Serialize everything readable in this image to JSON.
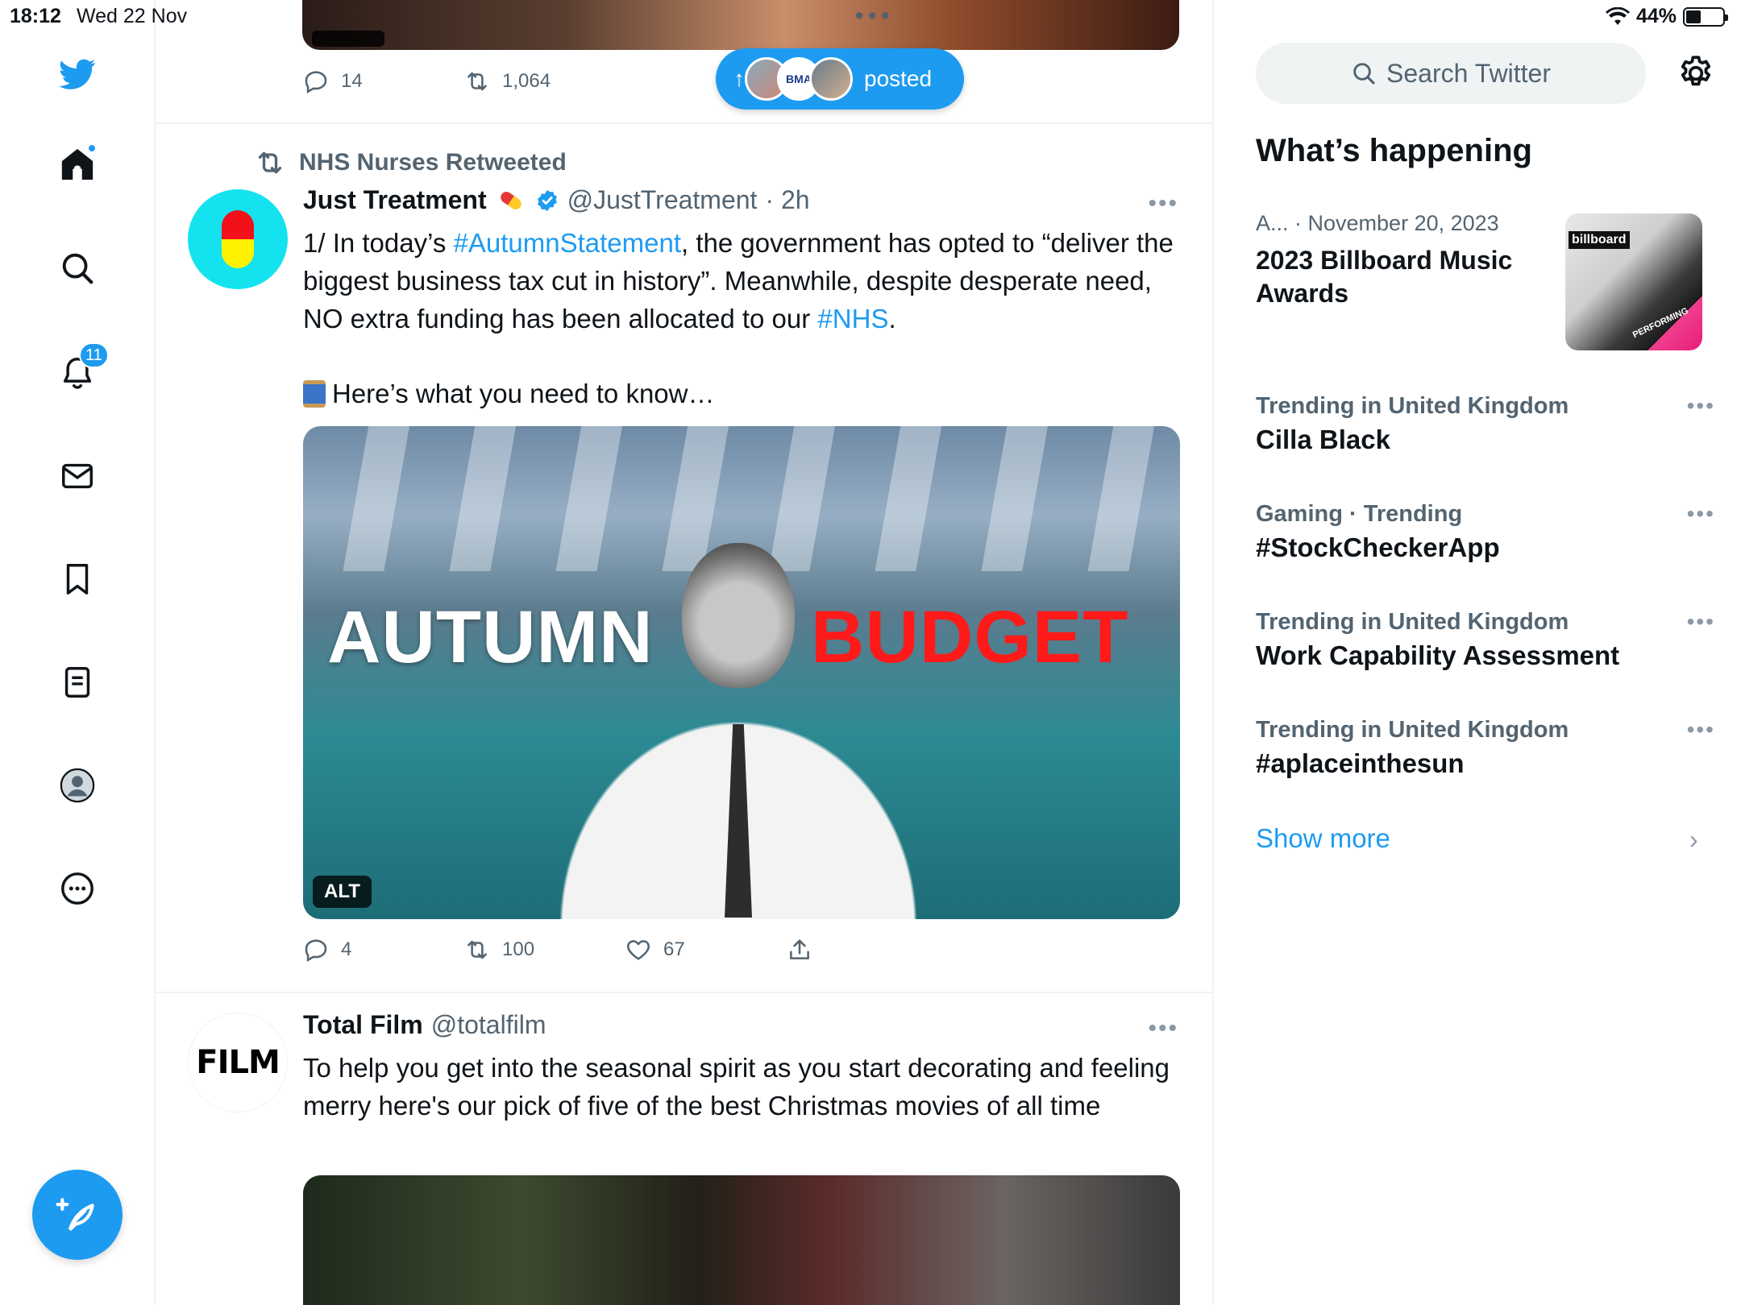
{
  "status": {
    "time": "18:12",
    "date": "Wed 22 Nov",
    "battery": "44%",
    "battery_level": 0.44
  },
  "icons": {
    "logo": "twitter-bird-icon",
    "home": "home-icon",
    "explore": "search-icon",
    "notifications": "bell-icon",
    "messages": "mail-icon",
    "bookmarks": "bookmark-icon",
    "lists": "list-icon",
    "profile": "profile-icon",
    "more": "more-circle-icon",
    "compose": "compose-feather-icon"
  },
  "nav": {
    "notifications_count": "11"
  },
  "colors": {
    "accent": "#1d9bf0",
    "text": "#0f1419",
    "muted": "#536471",
    "border": "#eff3f4"
  },
  "timeline": {
    "prev_tweet": {
      "replies": "14",
      "retweets": "1,064"
    },
    "new_posts_pill": {
      "label": "posted",
      "avatar_text": "BMA"
    },
    "tweet1": {
      "retweeted_by": "NHS Nurses Retweeted",
      "name": "Just Treatment",
      "handle": "@JustTreatment",
      "time": "· 2h",
      "text_a": "1/ In today’s ",
      "hashtag1": "#AutumnStatement",
      "text_b": ", the government has opted to “deliver the biggest business tax cut in history”. Meanwhile, despite desperate need, NO extra funding has been allocated to our ",
      "hashtag2": "#NHS",
      "text_c": ".",
      "text_2": "Here’s what you need to know…",
      "image_word1": "AUTUMN",
      "image_word2": "BUDGET",
      "alt": "ALT",
      "replies": "4",
      "retweets": "100",
      "likes": "67"
    },
    "tweet2": {
      "name": "Total Film",
      "handle": "@totalfilm",
      "avatar_text": "FILM",
      "text": "To help you get into the seasonal spirit as you start decorating and feeling merry here's our pick of five of the best Christmas movies of all time"
    }
  },
  "sidebar": {
    "search_placeholder": "Search Twitter",
    "whats_happening": "What’s happening",
    "feature": {
      "source": "A...",
      "date": "· November 20, 2023",
      "title": "2023 Billboard Music Awards",
      "thumb_brand": "billboard",
      "thumb_banner": "PERFORMING"
    },
    "trends": [
      {
        "context": "Trending in United Kingdom",
        "title": "Cilla Black"
      },
      {
        "context": "Gaming · Trending",
        "title": "#StockCheckerApp"
      },
      {
        "context": "Trending in United Kingdom",
        "title": "Work Capability Assessment"
      },
      {
        "context": "Trending in United Kingdom",
        "title": "#aplaceinthesun"
      }
    ],
    "show_more": "Show more"
  }
}
